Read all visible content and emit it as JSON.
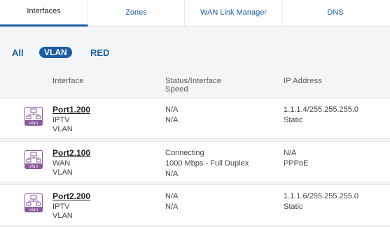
{
  "tabs": [
    {
      "label": "Interfaces",
      "active": true
    },
    {
      "label": "Zones",
      "active": false
    },
    {
      "label": "WAN Link Manager",
      "active": false
    },
    {
      "label": "DNS",
      "active": false
    }
  ],
  "filters": {
    "all": "All",
    "vlan": "VLAN",
    "red": "RED",
    "selected": "VLAN"
  },
  "columns": {
    "interface": "Interface",
    "status": "Status/Interface Speed",
    "ip": "IP Address"
  },
  "rows": [
    {
      "icon": "vlan-icon",
      "name": "Port1.200",
      "zone": "IPTV",
      "type": "VLAN",
      "status": [
        "N/A",
        "N/A"
      ],
      "ip": "1.1.1.4/255.255.255.0",
      "ip_mode": "Static"
    },
    {
      "icon": "vlan-icon",
      "name": "Port2.100",
      "zone": "WAN",
      "type": "VLAN",
      "status": [
        "Connecting",
        "1000 Mbps - Full Duplex",
        "N/A"
      ],
      "ip": "N/A",
      "ip_mode": "PPPoE"
    },
    {
      "icon": "vlan-icon",
      "name": "Port2.200",
      "zone": "IPTV",
      "type": "VLAN",
      "status": [
        "N/A",
        "N/A"
      ],
      "ip": "1.1.1.6/255.255.255.0",
      "ip_mode": "Static"
    }
  ],
  "icon_label": "vlan",
  "colors": {
    "accent": "#1c5da3",
    "icon": "#8a5a9c"
  }
}
